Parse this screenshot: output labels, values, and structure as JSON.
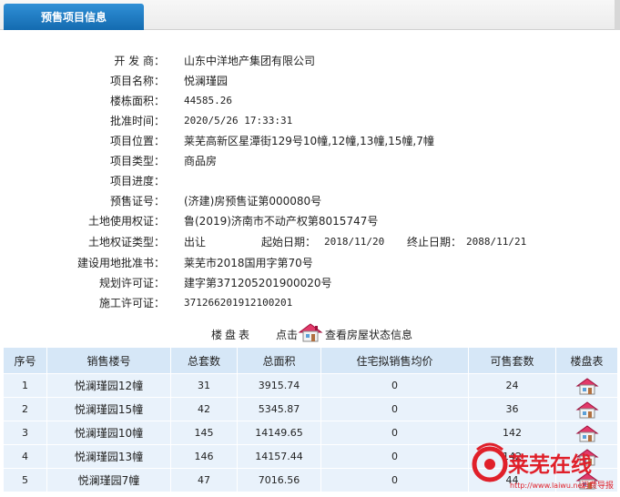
{
  "tab": {
    "label": "预售项目信息"
  },
  "fields": [
    {
      "label": "开 发 商：",
      "value": "山东中洋地产集团有限公司"
    },
    {
      "label": "项目名称：",
      "value": "悦澜瑾园"
    },
    {
      "label": "楼栋面积：",
      "value": "44585.26"
    },
    {
      "label": "批准时间：",
      "value": "2020/5/26 17:33:31"
    },
    {
      "label": "项目位置：",
      "value": "莱芜高新区星潭街129号10幢,12幢,13幢,15幢,7幢"
    },
    {
      "label": "项目类型：",
      "value": "商品房"
    },
    {
      "label": "项目进度：",
      "value": ""
    },
    {
      "label": "预售证号：",
      "value": "(济建)房预售证第000080号"
    },
    {
      "label": "土地使用权证：",
      "value": "鲁(2019)济南市不动产权第8015747号"
    },
    {
      "label": "土地权证类型：",
      "value": "出让"
    },
    {
      "label": "建设用地批准书：",
      "value": "莱芜市2018国用字第70号"
    },
    {
      "label": "规划许可证：",
      "value": "建字第371205201900020号"
    },
    {
      "label": "施工许可证：",
      "value": "371266201912100201"
    }
  ],
  "land_dates": {
    "start_label": "起始日期：",
    "start_value": "2018/11/20",
    "end_label": "终止日期：",
    "end_value": "2088/11/21"
  },
  "table_heading": {
    "title": "楼盘表",
    "prefix": "点击",
    "link": "查看房屋状态信息"
  },
  "table": {
    "headers": [
      "序号",
      "销售楼号",
      "总套数",
      "总面积",
      "住宅拟销售均价",
      "可售套数",
      "楼盘表"
    ],
    "rows": [
      {
        "no": "1",
        "name": "悦澜瑾园12幢",
        "units": "31",
        "area": "3915.74",
        "price": "0",
        "avail": "24"
      },
      {
        "no": "2",
        "name": "悦澜瑾园15幢",
        "units": "42",
        "area": "5345.87",
        "price": "0",
        "avail": "36"
      },
      {
        "no": "3",
        "name": "悦澜瑾园10幢",
        "units": "145",
        "area": "14149.65",
        "price": "0",
        "avail": "142"
      },
      {
        "no": "4",
        "name": "悦澜瑾园13幢",
        "units": "146",
        "area": "14157.44",
        "price": "0",
        "avail": "142"
      },
      {
        "no": "5",
        "name": "悦澜瑾园7幢",
        "units": "47",
        "area": "7016.56",
        "price": "0",
        "avail": "44"
      }
    ]
  },
  "watermark": {
    "brand": "莱芜在线",
    "url": "http://www.laiwu.net",
    "tag": "消费导报"
  },
  "colors": {
    "tab": "#1c78c0",
    "header_bg": "#d6e7f7",
    "row_bg": "#e9f2fb",
    "watermark": "#e0202a"
  },
  "icons": {
    "house": "house-icon",
    "building_status": "house-icon"
  }
}
